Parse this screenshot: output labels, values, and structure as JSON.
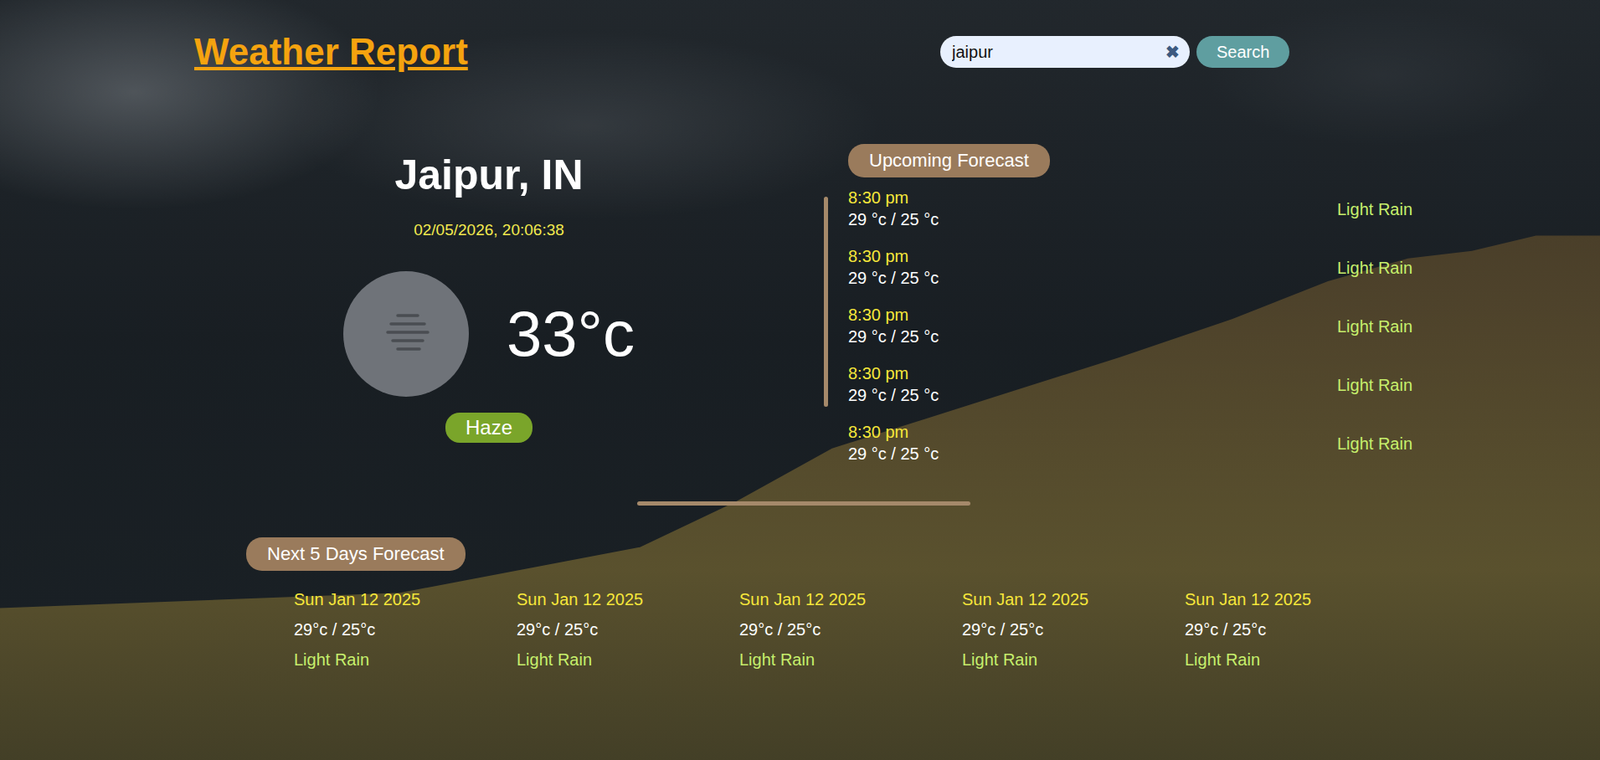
{
  "header": {
    "title": "Weather Report"
  },
  "search": {
    "value": "jaipur",
    "clear_icon": "✖",
    "button": "Search"
  },
  "current": {
    "location": "Jaipur, IN",
    "datetime": "02/05/2026, 20:06:38",
    "temperature": "33°c",
    "condition": "Haze"
  },
  "upcoming": {
    "title": "Upcoming Forecast",
    "items": [
      {
        "time": "8:30 pm",
        "temps": "29 °c / 25 °c",
        "description": "Light Rain"
      },
      {
        "time": "8:30 pm",
        "temps": "29 °c / 25 °c",
        "description": "Light Rain"
      },
      {
        "time": "8:30 pm",
        "temps": "29 °c / 25 °c",
        "description": "Light Rain"
      },
      {
        "time": "8:30 pm",
        "temps": "29 °c / 25 °c",
        "description": "Light Rain"
      },
      {
        "time": "8:30 pm",
        "temps": "29 °c / 25 °c",
        "description": "Light Rain"
      }
    ]
  },
  "daily": {
    "title": "Next 5 Days Forecast",
    "items": [
      {
        "date": "Sun Jan 12 2025",
        "temps": "29°c / 25°c",
        "description": "Light Rain"
      },
      {
        "date": "Sun Jan 12 2025",
        "temps": "29°c / 25°c",
        "description": "Light Rain"
      },
      {
        "date": "Sun Jan 12 2025",
        "temps": "29°c / 25°c",
        "description": "Light Rain"
      },
      {
        "date": "Sun Jan 12 2025",
        "temps": "29°c / 25°c",
        "description": "Light Rain"
      },
      {
        "date": "Sun Jan 12 2025",
        "temps": "29°c / 25°c",
        "description": "Light Rain"
      }
    ]
  }
}
